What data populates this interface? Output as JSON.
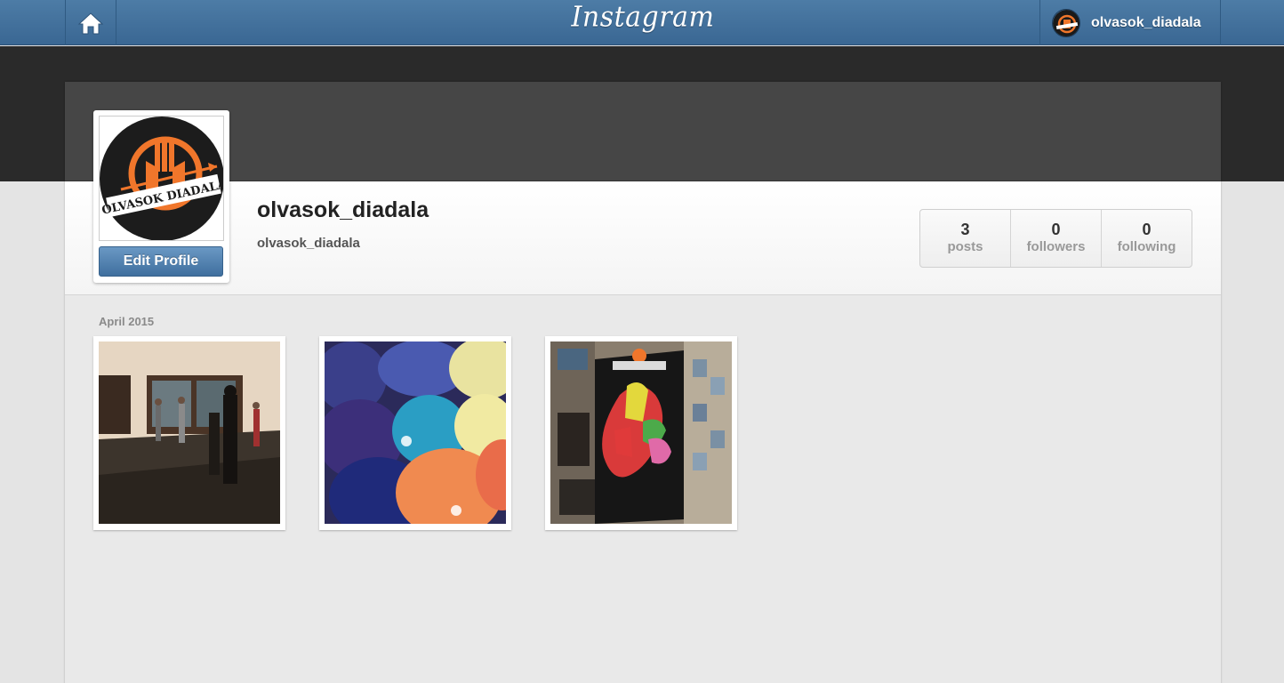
{
  "header": {
    "brand": "Instagram",
    "username": "olvasok_diadala",
    "icons": {
      "home": "home-icon"
    }
  },
  "profile": {
    "username": "olvasok_diadala",
    "full_name": "olvasok_diadala",
    "edit_button_label": "Edit Profile",
    "avatar_logo_text": "OLVASOK DIADALA",
    "stats": [
      {
        "value": "3",
        "label": "posts"
      },
      {
        "value": "0",
        "label": "followers"
      },
      {
        "value": "0",
        "label": "following"
      }
    ]
  },
  "feed": {
    "date_label": "April 2015",
    "photos": [
      {
        "name": "photo-courtyard-dance"
      },
      {
        "name": "photo-backpacks"
      },
      {
        "name": "photo-wall-map"
      }
    ]
  },
  "colors": {
    "nav_blue": "#3f6d98",
    "accent_orange": "#f0762b",
    "button_blue": "#4a7aa8"
  }
}
